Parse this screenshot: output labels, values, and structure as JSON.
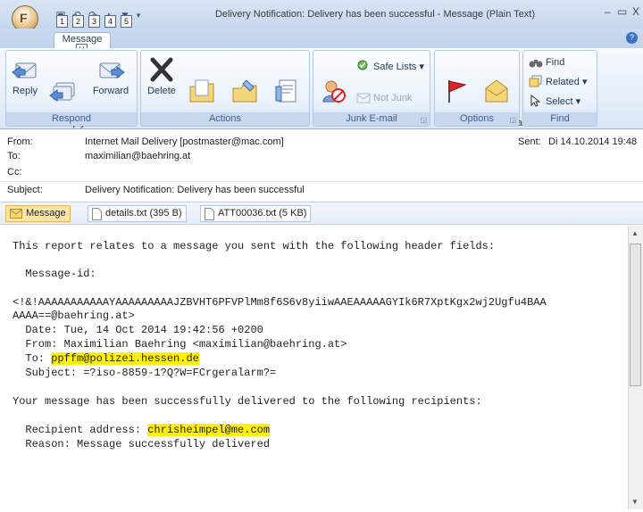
{
  "window": {
    "title": "Delivery Notification: Delivery has been successful - Message (Plain Text)",
    "minimize_icon": "minimize-icon",
    "maximize_icon": "maximize-icon",
    "close_glyph": "X"
  },
  "office_button": {
    "label": "F"
  },
  "quick_access": {
    "keys": [
      "1",
      "2",
      "3",
      "4",
      "5"
    ]
  },
  "ribbon_tabs": {
    "active": "Message",
    "key_tip": "H"
  },
  "ribbon": {
    "respond": {
      "label": "Respond",
      "reply": "Reply",
      "reply_all": "Reply\nto All",
      "forward": "Forward"
    },
    "actions": {
      "label": "Actions",
      "delete": "Delete",
      "move_to_folder": "Move to\nFolder ▾",
      "create_rule": "Create\nRule",
      "other_actions": "Other\nActions ▾"
    },
    "junk": {
      "label": "Junk E-mail",
      "block_sender": "Block\nSender",
      "safe_lists": "Safe Lists ▾",
      "not_junk": "Not Junk"
    },
    "options": {
      "label": "Options",
      "follow_up": "Follow\nUp ▾",
      "mark_unread": "Mark as\nUnread"
    },
    "find": {
      "label": "Find",
      "find": "Find",
      "related": "Related ▾",
      "select": "Select ▾"
    }
  },
  "header": {
    "from_label": "From:",
    "from_value": "Internet Mail Delivery [postmaster@mac.com]",
    "to_label": "To:",
    "to_value": "maximilian@baehring.at",
    "cc_label": "Cc:",
    "subject_label": "Subject:",
    "subject_value": "Delivery Notification: Delivery has been successful",
    "sent_label": "Sent:",
    "sent_value": "Di 14.10.2014 19:48"
  },
  "attachments": [
    {
      "label": "Message"
    },
    {
      "label": "details.txt (395 B)"
    },
    {
      "label": "ATT00036.txt (5 KB)"
    }
  ],
  "body": {
    "line1": "This report relates to a message you sent with the following header fields:",
    "line2": "  Message-id:",
    "line3": "<!&!AAAAAAAAAAAYAAAAAAAAAJZBVHT6PFVPlMm8f6S6v8yiiwAAEAAAAAGYIk6R7XptKgx2wj2Ugfu4BAA",
    "line4": "AAAA==@baehring.at>",
    "line5": "  Date: Tue, 14 Oct 2014 19:42:56 +0200",
    "line6": "  From: Maximilian Baehring <maximilian@baehring.at>",
    "line7_prefix": "  To: ",
    "line7_highlight": "ppffm@polizei.hessen.de",
    "line8": "  Subject: =?iso-8859-1?Q?W=FCrgeralarm?=",
    "line9": "Your message has been successfully delivered to the following recipients:",
    "line10_prefix": "  Recipient address: ",
    "line10_highlight": "chrisheimpel@me.com",
    "line11": "  Reason: Message successfully delivered"
  },
  "colors": {
    "highlight": "#fff200",
    "ribbon_text": "#1e395b"
  }
}
